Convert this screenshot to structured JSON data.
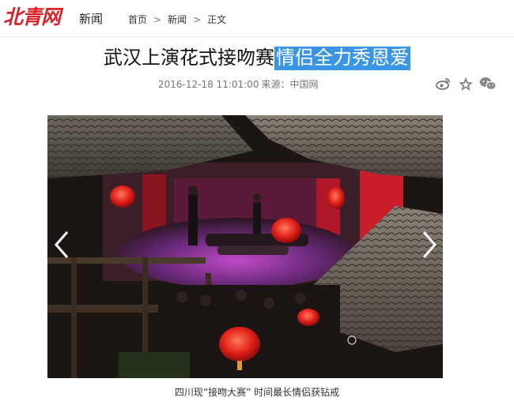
{
  "header": {
    "logo_text": "北青网",
    "section_label": "新闻",
    "breadcrumb": [
      "首页",
      "新闻",
      "正文"
    ],
    "breadcrumb_separator": ">"
  },
  "article": {
    "title_main": "武汉上演花式接吻赛",
    "title_highlight": "情侣全力秀恩爱",
    "datetime": "2016-12-18 11:01:00",
    "source_label": "来源：",
    "source_name": "中国网"
  },
  "share": {
    "icons": [
      "weibo-icon",
      "star-icon",
      "wechat-icon"
    ]
  },
  "gallery": {
    "caption": "四川现“接吻大赛” 时间最长情侣获钻戒",
    "prev_symbol": "‹",
    "next_symbol": "›"
  },
  "colors": {
    "brand_red": "#d8232a",
    "highlight_blue": "#3a95e6"
  }
}
